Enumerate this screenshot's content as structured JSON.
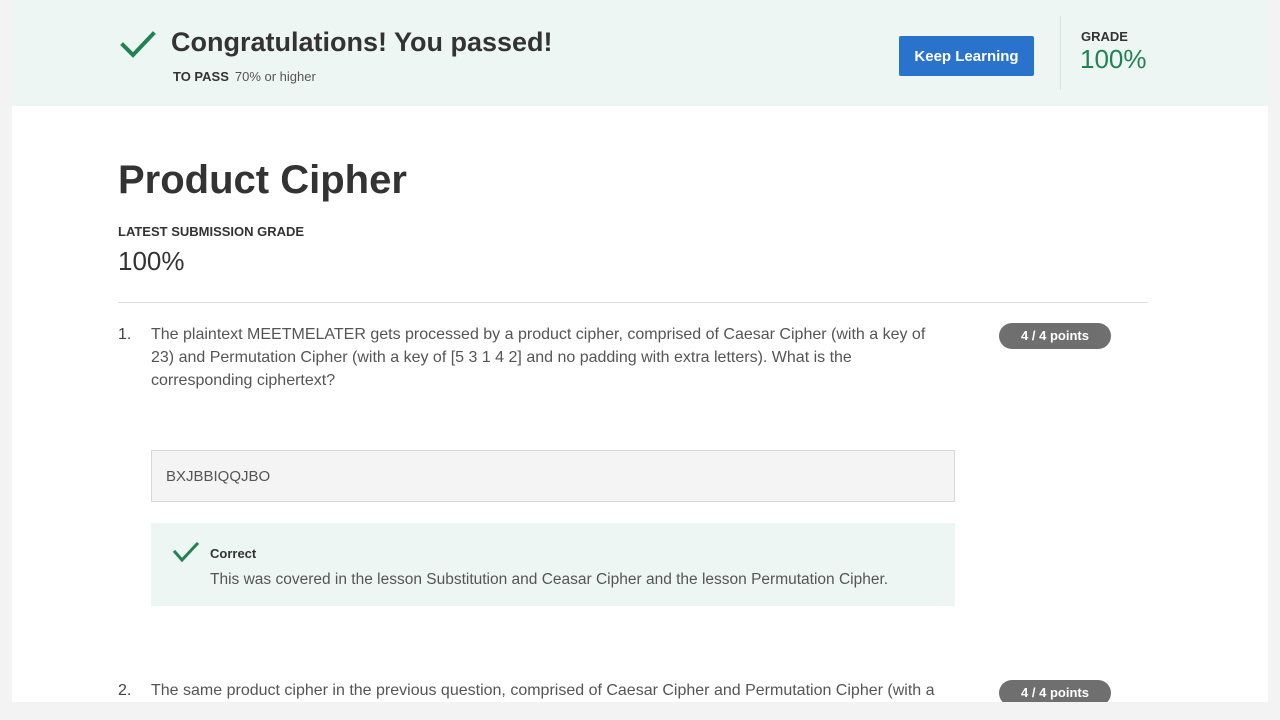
{
  "banner": {
    "title": "Congratulations! You passed!",
    "to_pass_label": "TO PASS",
    "to_pass_value": "70% or higher",
    "keep_learning_label": "Keep Learning",
    "grade_label": "GRADE",
    "grade_value": "100%"
  },
  "quiz": {
    "title": "Product Cipher",
    "latest_label": "LATEST SUBMISSION GRADE",
    "latest_value": "100%"
  },
  "questions": [
    {
      "number": "1.",
      "text": "The plaintext MEETMELATER gets processed by a product cipher, comprised of Caesar Cipher (with a key of 23) and Permutation Cipher (with a key of [5 3 1 4 2] and no padding with extra letters). What is the corresponding ciphertext?",
      "points": "4 / 4 points",
      "answer": "BXJBBIQQJBO",
      "feedback_title": "Correct",
      "feedback_text": "This was covered in the lesson Substitution and Ceasar Cipher and the lesson Permutation Cipher."
    },
    {
      "number": "2.",
      "text": "The same product cipher in the previous question, comprised of Caesar Cipher and Permutation Cipher (with a",
      "points": "4 / 4 points"
    }
  ],
  "colors": {
    "accent": "#2a73cc",
    "success": "#1f8354",
    "banner_bg": "#eef6f3"
  }
}
